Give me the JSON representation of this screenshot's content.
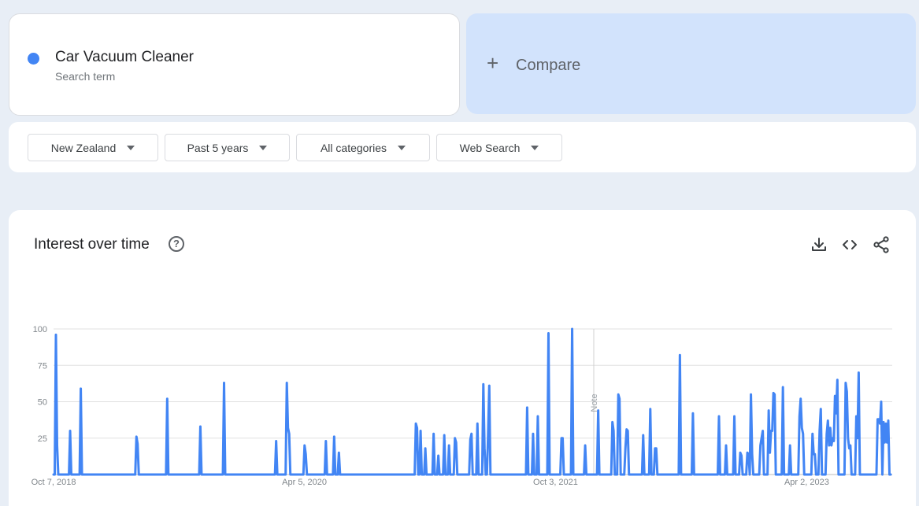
{
  "search_term": {
    "name": "Car Vacuum Cleaner",
    "sub": "Search term",
    "color": "#4285f4"
  },
  "compare": {
    "label": "Compare",
    "icon": "plus-icon"
  },
  "filters": [
    {
      "label": "New Zealand"
    },
    {
      "label": "Past 5 years"
    },
    {
      "label": "All categories"
    },
    {
      "label": "Web Search"
    }
  ],
  "panel": {
    "title": "Interest over time",
    "icons": [
      "help-icon",
      "download-icon",
      "embed-icon",
      "share-icon"
    ]
  },
  "chart_data": {
    "type": "line",
    "title": "Interest over time",
    "ylim": [
      0,
      100
    ],
    "yticks": [
      100,
      75,
      50,
      25
    ],
    "xtick_labels": [
      "Oct 7, 2018",
      "Apr 5, 2020",
      "Oct 3, 2021",
      "Apr 2, 2023"
    ],
    "note_label": "Note",
    "grid": true,
    "color": "#4285f4",
    "series": [
      {
        "values": [
          0,
          0,
          96,
          20,
          0,
          0,
          0,
          0,
          0,
          0,
          0,
          0,
          0,
          0,
          30,
          0,
          0,
          0,
          0,
          0,
          0,
          0,
          0,
          59,
          0,
          0,
          0,
          0,
          0,
          0,
          0,
          0,
          0,
          0,
          0,
          0,
          0,
          0,
          0,
          0,
          0,
          0,
          0,
          0,
          0,
          0,
          0,
          0,
          0,
          0,
          0,
          0,
          0,
          0,
          0,
          0,
          0,
          0,
          0,
          0,
          0,
          0,
          0,
          0,
          0,
          0,
          0,
          0,
          0,
          0,
          26,
          21,
          0,
          0,
          0,
          0,
          0,
          0,
          0,
          0,
          0,
          0,
          0,
          0,
          0,
          0,
          0,
          0,
          0,
          0,
          0,
          0,
          0,
          0,
          0,
          0,
          52,
          0,
          0,
          0,
          0,
          0,
          0,
          0,
          0,
          0,
          0,
          0,
          0,
          0,
          0,
          0,
          0,
          0,
          0,
          0,
          0,
          0,
          0,
          0,
          0,
          0,
          0,
          0,
          33,
          0,
          0,
          0,
          0,
          0,
          0,
          0,
          0,
          0,
          0,
          0,
          0,
          0,
          0,
          0,
          0,
          0,
          0,
          0,
          63,
          0,
          0,
          0,
          0,
          0,
          0,
          0,
          0,
          0,
          0,
          0,
          0,
          0,
          0,
          0,
          0,
          0,
          0,
          0,
          0,
          0,
          0,
          0,
          0,
          0,
          0,
          0,
          0,
          0,
          0,
          0,
          0,
          0,
          0,
          0,
          0,
          0,
          0,
          0,
          0,
          0,
          0,
          0,
          23,
          0,
          0,
          0,
          0,
          0,
          0,
          0,
          0,
          63,
          32,
          28,
          0,
          0,
          0,
          0,
          0,
          0,
          0,
          0,
          0,
          0,
          0,
          0,
          20,
          14,
          0,
          0,
          0,
          0,
          0,
          0,
          0,
          0,
          0,
          0,
          0,
          0,
          0,
          0,
          0,
          0,
          23,
          0,
          0,
          0,
          0,
          0,
          0,
          26,
          0,
          0,
          0,
          15,
          0,
          0,
          0,
          0,
          0,
          0,
          0,
          0,
          0,
          0,
          0,
          0,
          0,
          0,
          0,
          0,
          0,
          0,
          0,
          0,
          0,
          0,
          0,
          0,
          0,
          0,
          0,
          0,
          0,
          0,
          0,
          0,
          0,
          0,
          0,
          0,
          0,
          0,
          0,
          0,
          0,
          0,
          0,
          0,
          0,
          0,
          0,
          0,
          0,
          0,
          0,
          0,
          0,
          0,
          0,
          0,
          0,
          0,
          0,
          0,
          0,
          0,
          0,
          0,
          35,
          32,
          0,
          0,
          30,
          0,
          0,
          0,
          18,
          0,
          0,
          0,
          0,
          0,
          0,
          28,
          0,
          0,
          0,
          13,
          0,
          0,
          0,
          0,
          27,
          0,
          0,
          0,
          20,
          0,
          0,
          0,
          0,
          25,
          22,
          0,
          0,
          0,
          0,
          0,
          0,
          0,
          0,
          0,
          0,
          0,
          24,
          28,
          0,
          0,
          0,
          0,
          35,
          0,
          0,
          0,
          0,
          62,
          18,
          0,
          0,
          27,
          61,
          0,
          0,
          0,
          0,
          0,
          0,
          0,
          0,
          0,
          0,
          0,
          0,
          0,
          0,
          0,
          0,
          0,
          0,
          0,
          0,
          0,
          0,
          0,
          0,
          0,
          0,
          0,
          0,
          0,
          0,
          0,
          46,
          0,
          0,
          0,
          0,
          28,
          0,
          0,
          0,
          40,
          0,
          0,
          0,
          0,
          0,
          0,
          0,
          0,
          97,
          0,
          0,
          0,
          0,
          0,
          0,
          0,
          0,
          0,
          0,
          25,
          25,
          0,
          0,
          0,
          0,
          0,
          0,
          0,
          100,
          0,
          0,
          0,
          0,
          0,
          0,
          0,
          0,
          0,
          0,
          20,
          0,
          0,
          0,
          0,
          0,
          0,
          0,
          0,
          0,
          0,
          44,
          0,
          0,
          0,
          0,
          0,
          0,
          0,
          0,
          0,
          0,
          0,
          36,
          30,
          0,
          0,
          0,
          55,
          52,
          0,
          0,
          0,
          0,
          18,
          31,
          30,
          0,
          0,
          0,
          0,
          0,
          0,
          0,
          0,
          0,
          0,
          0,
          0,
          27,
          0,
          0,
          0,
          0,
          0,
          45,
          0,
          0,
          0,
          18,
          18,
          0,
          0,
          0,
          0,
          0,
          0,
          0,
          0,
          0,
          0,
          0,
          0,
          0,
          0,
          0,
          0,
          0,
          0,
          0,
          82,
          0,
          0,
          0,
          0,
          0,
          0,
          0,
          0,
          0,
          0,
          42,
          0,
          0,
          0,
          0,
          0,
          0,
          0,
          0,
          0,
          0,
          0,
          0,
          0,
          0,
          0,
          0,
          0,
          0,
          0,
          0,
          0,
          40,
          0,
          0,
          0,
          0,
          0,
          20,
          0,
          0,
          0,
          0,
          0,
          0,
          40,
          0,
          0,
          0,
          0,
          15,
          13,
          0,
          0,
          0,
          0,
          15,
          14,
          0,
          55,
          14,
          0,
          0,
          0,
          0,
          0,
          0,
          20,
          25,
          30,
          0,
          0,
          0,
          0,
          44,
          15,
          30,
          30,
          56,
          55,
          0,
          0,
          0,
          0,
          0,
          0,
          60,
          0,
          0,
          0,
          0,
          0,
          20,
          0,
          0,
          0,
          0,
          0,
          0,
          0,
          40,
          52,
          32,
          28,
          0,
          0,
          0,
          0,
          0,
          0,
          0,
          28,
          14,
          14,
          0,
          0,
          0,
          30,
          45,
          0,
          0,
          0,
          0,
          28,
          37,
          20,
          32,
          20,
          25,
          23,
          54,
          42,
          65,
          0,
          0,
          0,
          0,
          0,
          0,
          63,
          57,
          25,
          18,
          20,
          0,
          0,
          0,
          0,
          40,
          25,
          70,
          0,
          0,
          0,
          0,
          0,
          0,
          0,
          0,
          0,
          0,
          0,
          0,
          0,
          0,
          0,
          38,
          38,
          35,
          50,
          0,
          36,
          22,
          35,
          22,
          37,
          0,
          0
        ]
      }
    ]
  }
}
